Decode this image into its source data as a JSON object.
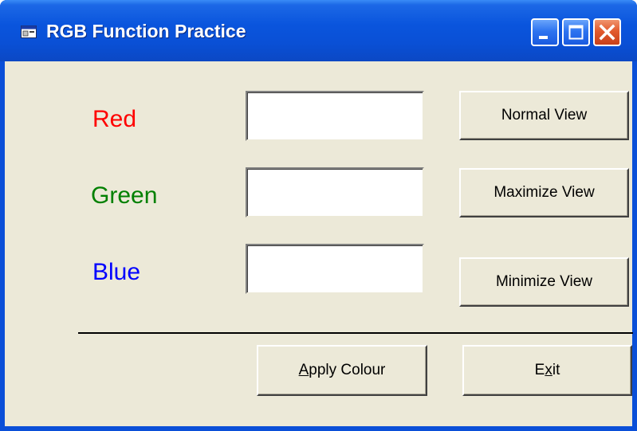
{
  "window": {
    "title": "RGB Function Practice",
    "controls": {
      "minimize": "minimize-icon",
      "maximize": "maximize-icon",
      "close": "close-icon"
    }
  },
  "labels": {
    "red": {
      "text": "Red",
      "color": "#ff0000"
    },
    "green": {
      "text": "Green",
      "color": "#008000"
    },
    "blue": {
      "text": "Blue",
      "color": "#0000ff"
    }
  },
  "inputs": {
    "red_value": "",
    "green_value": "",
    "blue_value": ""
  },
  "buttons": {
    "normal_view": "Normal View",
    "maximize_view": "Maximize View",
    "minimize_view": "Minimize View",
    "apply_colour": {
      "pre": "",
      "accel": "A",
      "post": "pply Colour"
    },
    "exit": {
      "pre": "E",
      "accel": "x",
      "post": "it"
    }
  },
  "colors": {
    "titlebar": "#0a55dd",
    "client_background": "#ece9d8",
    "close_button": "#e25a2e"
  }
}
